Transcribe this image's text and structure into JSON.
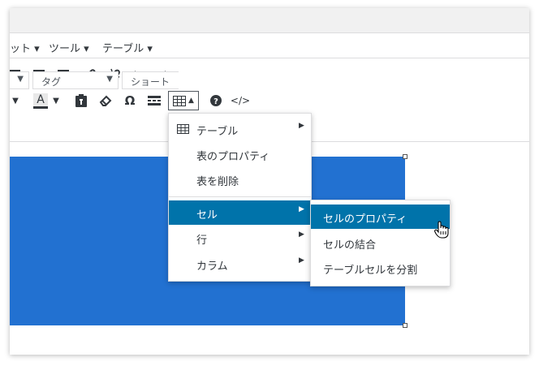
{
  "menubar": {
    "items": [
      {
        "label": "ット"
      },
      {
        "label": "ツール"
      },
      {
        "label": "テーブル"
      }
    ]
  },
  "toolbar": {
    "row1_icons": [
      "align-left-icon",
      "align-center-icon",
      "align-right-icon",
      "link-icon",
      "unlink-icon",
      "undo-icon",
      "redo-icon"
    ],
    "text_color_label": "A",
    "omega": "Ω",
    "code": "</>",
    "format_select": "",
    "tag_select": "タグ",
    "shortcode_select": "ショート"
  },
  "table_menu": {
    "items": [
      {
        "label": "テーブル",
        "has_submenu": true
      },
      {
        "label": "表のプロパティ",
        "has_submenu": false
      },
      {
        "label": "表を削除",
        "has_submenu": false
      },
      {
        "label": "セル",
        "has_submenu": true,
        "active": true
      },
      {
        "label": "行",
        "has_submenu": true
      },
      {
        "label": "カラム",
        "has_submenu": true
      }
    ]
  },
  "cell_submenu": {
    "items": [
      {
        "label": "セルのプロパティ",
        "active": true
      },
      {
        "label": "セルの結合"
      },
      {
        "label": "テーブルセルを分割"
      }
    ]
  },
  "colors": {
    "accent": "#0073aa",
    "table_fill": "#2271d1"
  }
}
